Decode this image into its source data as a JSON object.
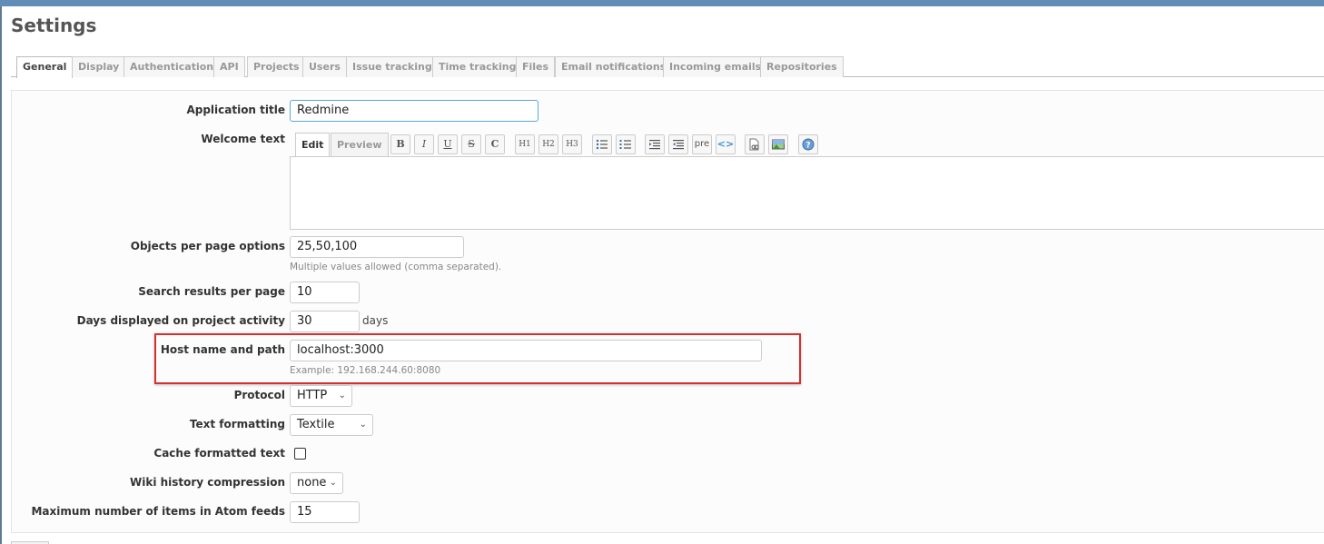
{
  "page": {
    "title": "Settings"
  },
  "tabs": [
    {
      "label": "General",
      "selected": true
    },
    {
      "label": "Display"
    },
    {
      "label": "Authentication"
    },
    {
      "label": "API"
    },
    {
      "label": "Projects"
    },
    {
      "label": "Users"
    },
    {
      "label": "Issue tracking"
    },
    {
      "label": "Time tracking"
    },
    {
      "label": "Files"
    },
    {
      "label": "Email notifications"
    },
    {
      "label": "Incoming emails"
    },
    {
      "label": "Repositories"
    }
  ],
  "fields": {
    "app_title": {
      "label": "Application title",
      "value": "Redmine"
    },
    "welcome_text": {
      "label": "Welcome text",
      "edit_tab": "Edit",
      "preview_tab": "Preview"
    },
    "objects_per_page": {
      "label": "Objects per page options",
      "value": "25,50,100",
      "hint": "Multiple values allowed (comma separated)."
    },
    "search_results": {
      "label": "Search results per page",
      "value": "10"
    },
    "days_displayed": {
      "label": "Days displayed on project activity",
      "value": "30",
      "unit": "days"
    },
    "host_name": {
      "label": "Host name and path",
      "value": "localhost:3000",
      "hint": "Example: 192.168.244.60:8080"
    },
    "protocol": {
      "label": "Protocol",
      "value": "HTTP"
    },
    "text_formatting": {
      "label": "Text formatting",
      "value": "Textile"
    },
    "cache_formatted": {
      "label": "Cache formatted text",
      "checked": false
    },
    "wiki_compression": {
      "label": "Wiki history compression",
      "value": "none"
    },
    "atom_items": {
      "label": "Maximum number of items in Atom feeds",
      "value": "15"
    }
  },
  "toolbar": {
    "bold": "B",
    "italic": "I",
    "underline": "U",
    "strike": "S",
    "code": "C",
    "h1": "H1",
    "h2": "H2",
    "h3": "H3",
    "pre": "pre"
  },
  "colors": {
    "accent_bar": "#628db6",
    "highlight": "#d43030",
    "focus": "#5ba7d8"
  }
}
